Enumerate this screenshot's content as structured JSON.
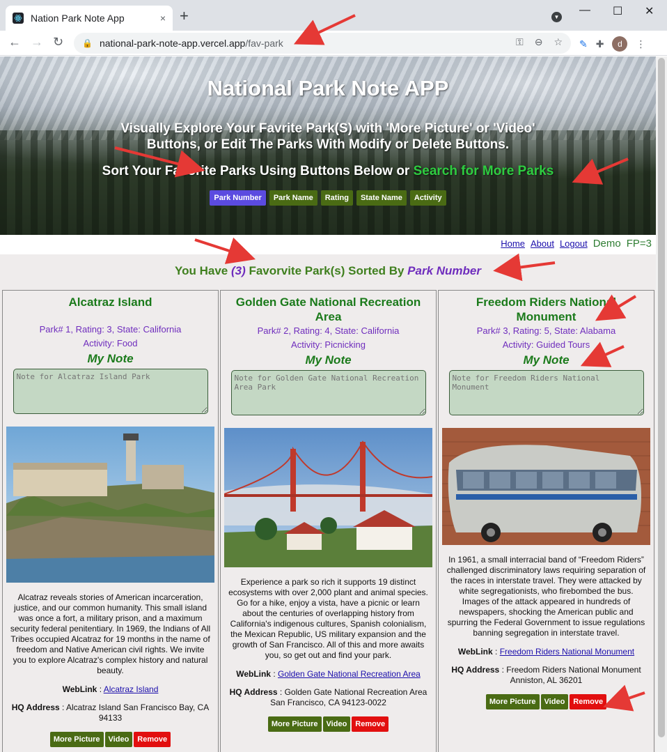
{
  "browser": {
    "tab_title": "Nation Park Note App",
    "tab_close": "×",
    "new_tab": "+",
    "url_host": "national-park-note-app.vercel.app",
    "url_path": "/fav-park",
    "avatar_letter": "d",
    "minimize": "—",
    "maximize": "☐",
    "close": "✕"
  },
  "hero": {
    "title": "National Park Note APP",
    "subtitle": "Visually Explore Your Favrite Park(S) with 'More Picture' or 'Video' Buttons, or Edit The Parks With Modify or Delete Buttons.",
    "sort_text": "Sort Your Favorite Parks Using Buttons Below or ",
    "search_link": "Search for More Parks",
    "sort_buttons": [
      "Park Number",
      "Park Name",
      "Rating",
      "State Name",
      "Activity"
    ],
    "active_sort": "Park Number"
  },
  "nav": {
    "home": "Home",
    "about": "About",
    "logout": "Logout",
    "user": "Demo",
    "fp_count": "FP=3"
  },
  "summary": {
    "prefix": "You Have ",
    "count": "(3)",
    "middle": " Favorvite Park(s) Sorted By ",
    "sort_by": "Park Number"
  },
  "cards": [
    {
      "title": "Alcatraz Island",
      "meta": "Park# 1, Rating: 3, State: California",
      "activity": "Activity: Food",
      "note_label": "My Note",
      "note_placeholder": "Note for Alcatraz Island Park",
      "description": "Alcatraz reveals stories of American incarceration, justice, and our common humanity. This small island was once a fort, a military prison, and a maximum security federal penitentiary. In 1969, the Indians of All Tribes occupied Alcatraz for 19 months in the name of freedom and Native American civil rights. We invite you to explore Alcatraz's complex history and natural beauty.",
      "weblink_label": "WebLink",
      "weblink_text": "Alcatraz Island",
      "hq_label": "HQ Address",
      "hq_text": "Alcatraz Island San Francisco Bay, CA 94133",
      "buttons": [
        "More Picture",
        "Video",
        "Remove"
      ]
    },
    {
      "title": "Golden Gate National Recreation Area",
      "meta": "Park# 2, Rating: 4, State: California",
      "activity": "Activity: Picnicking",
      "note_label": "My Note",
      "note_placeholder": "Note for Golden Gate National Recreation Area Park",
      "description": "Experience a park so rich it supports 19 distinct ecosystems with over 2,000 plant and animal species. Go for a hike, enjoy a vista, have a picnic or learn about the centuries of overlapping history from California's indigenous cultures, Spanish colonialism, the Mexican Republic, US military expansion and the growth of San Francisco. All of this and more awaits you, so get out and find your park.",
      "weblink_label": "WebLink",
      "weblink_text": "Golden Gate National Recreation Area",
      "hq_label": "HQ Address",
      "hq_text": "Golden Gate National Recreation Area San Francisco, CA 94123-0022",
      "buttons": [
        "More Picture",
        "Video",
        "Remove"
      ]
    },
    {
      "title": "Freedom Riders National Monument",
      "meta": "Park# 3, Rating: 5, State: Alabama",
      "activity": "Activity: Guided Tours",
      "note_label": "My Note",
      "note_placeholder": "Note for Freedom Riders National Monument",
      "description": "In 1961, a small interracial band of “Freedom Riders” challenged discriminatory laws requiring separation of the races in interstate travel. They were attacked by white segregationists, who firebombed the bus. Images of the attack appeared in hundreds of newspapers, shocking the American public and spurring the Federal Government to issue regulations banning segregation in interstate travel.",
      "weblink_label": "WebLink",
      "weblink_text": "Freedom Riders National Monument",
      "hq_label": "HQ Address",
      "hq_text": "Freedom Riders National Monument Anniston, AL 36201",
      "buttons": [
        "More Picture",
        "Video",
        "Remove"
      ]
    }
  ],
  "colors": {
    "green_button": "#4a6b14",
    "active_sort": "#5b4be0",
    "remove": "#e20f0f",
    "annotation_arrow": "#e53935"
  }
}
